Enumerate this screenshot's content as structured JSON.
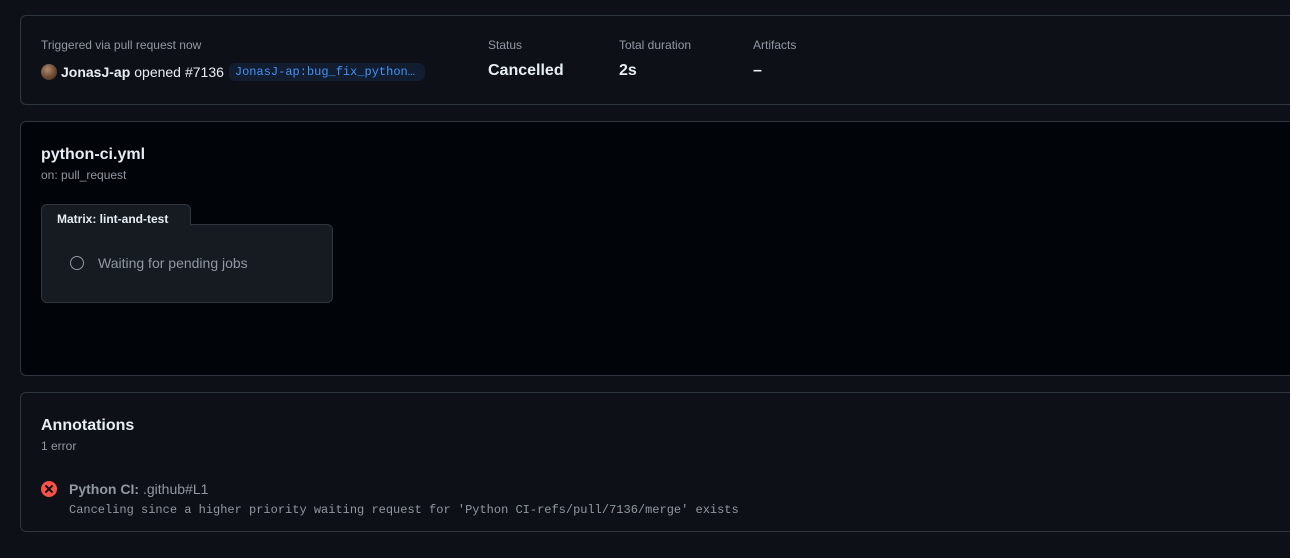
{
  "summary": {
    "trigger_label": "Triggered via pull request now",
    "user": "JonasJ-ap",
    "action": "opened",
    "pr_number": "#7136",
    "branch": "JonasJ-ap:bug_fix_python_…",
    "status_label": "Status",
    "status_value": "Cancelled",
    "duration_label": "Total duration",
    "duration_value": "2s",
    "artifacts_label": "Artifacts",
    "artifacts_value": "–"
  },
  "workflow": {
    "file_name": "python-ci.yml",
    "trigger": "on: pull_request",
    "matrix_label": "Matrix: lint-and-test",
    "job_status_text": "Waiting for pending jobs",
    "job_status_icon": "pending-circle-icon"
  },
  "annotations": {
    "title": "Annotations",
    "count": "1 error",
    "items": [
      {
        "icon": "error-x-circle-icon",
        "source": "Python CI:",
        "location": ".github#L1",
        "message": "Canceling since a higher priority waiting request for 'Python CI-refs/pull/7136/merge' exists"
      }
    ]
  },
  "colors": {
    "background": "#0d1117",
    "graph_background": "#010409",
    "border": "#30363d",
    "muted_text": "#9198a1",
    "branch_link": "#4493f8",
    "error": "#f85149"
  }
}
